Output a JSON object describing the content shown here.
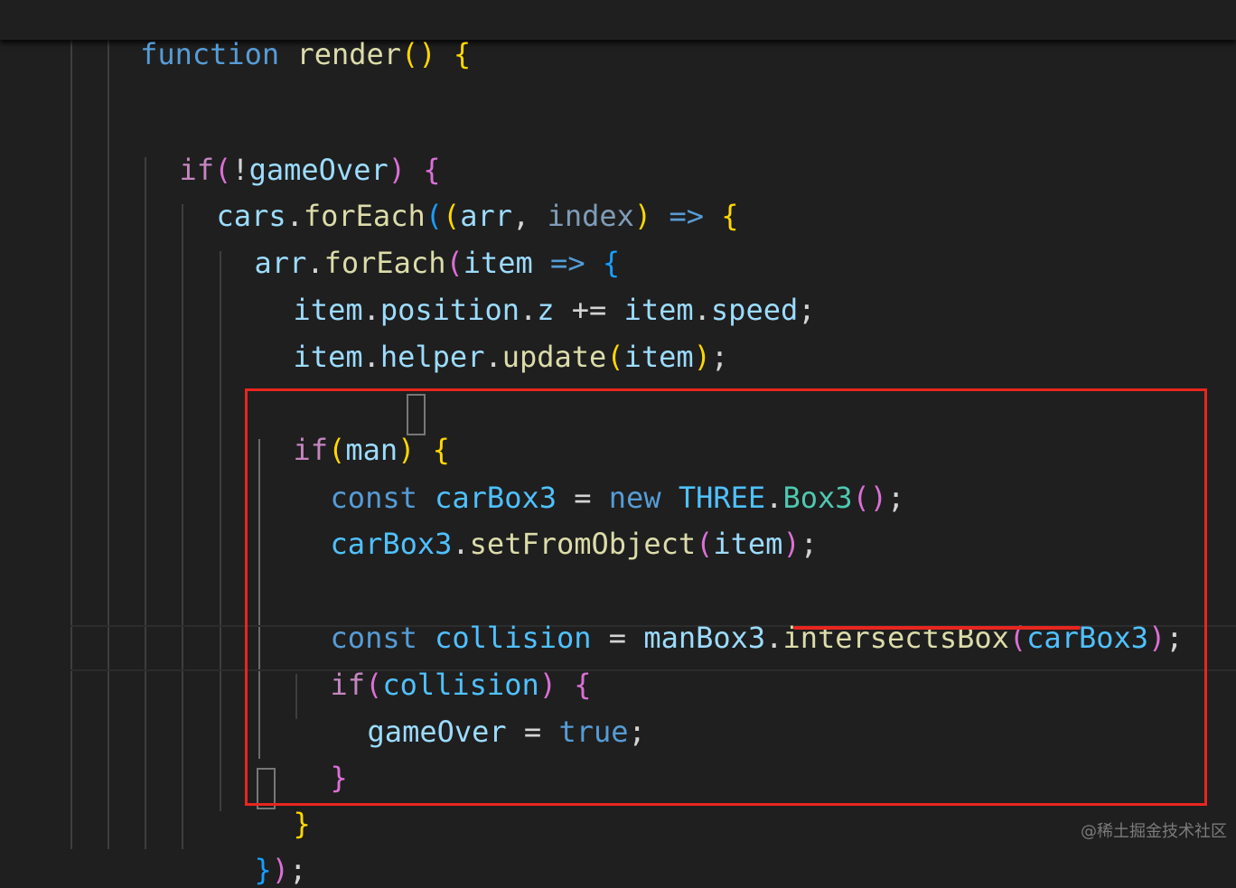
{
  "editor": {
    "sticky_line": {
      "kw": "function",
      "name": "render",
      "parens": "()",
      "brace": "{"
    },
    "partial_brace": "}",
    "line_if_gameover": {
      "kw": "if",
      "open": "(",
      "not": "!",
      "var": "gameOver",
      "close": ")",
      "brace": "{"
    },
    "line_cars_foreach": {
      "obj": "cars",
      "dot": ".",
      "method": "forEach",
      "open": "(",
      "open2": "(",
      "p1": "arr",
      "comma": ",",
      "p2": "index",
      "close2": ")",
      "arrow": "=>",
      "brace": "{"
    },
    "line_arr_foreach": {
      "obj": "arr",
      "dot": ".",
      "method": "forEach",
      "open": "(",
      "param": "item",
      "arrow": "=>",
      "brace": "{"
    },
    "line_position": {
      "obj": "item",
      "dot1": ".",
      "prop1": "position",
      "dot2": ".",
      "prop2": "z",
      "op": "+=",
      "obj2": "item",
      "dot3": ".",
      "prop3": "speed",
      "semi": ";"
    },
    "line_helper": {
      "obj": "item",
      "dot1": ".",
      "prop": "helper",
      "dot2": ".",
      "method": "update",
      "open": "(",
      "arg": "item",
      "close": ")",
      "semi": ";"
    },
    "line_if_man": {
      "kw": "if",
      "open": "(",
      "var": "man",
      "close": ")",
      "brace": "{"
    },
    "line_const_carbox": {
      "kw": "const",
      "name": "carBox3",
      "eq": "=",
      "new": "new",
      "ns": "THREE",
      "dot": ".",
      "cls": "Box3",
      "parens": "()",
      "semi": ";"
    },
    "line_setfrom": {
      "obj": "carBox3",
      "dot": ".",
      "method": "setFromObject",
      "open": "(",
      "arg": "item",
      "close": ")",
      "semi": ";"
    },
    "line_const_collision": {
      "kw": "const",
      "name": "collision",
      "eq": "=",
      "obj": "manBox3",
      "dot": ".",
      "method": "intersectsBox",
      "open": "(",
      "arg": "carBox3",
      "close": ")",
      "semi": ";"
    },
    "line_if_collision": {
      "kw": "if",
      "open": "(",
      "var": "collision",
      "close": ")",
      "brace": "{"
    },
    "line_gameover_true": {
      "var": "gameOver",
      "eq": "=",
      "val": "true",
      "semi": ";"
    },
    "line_close_collision": {
      "brace": "}"
    },
    "line_close_man": {
      "brace": "}"
    },
    "line_close_arr": {
      "brace": "}",
      "paren": ")",
      "semi": ";"
    }
  },
  "watermark": "@稀土掘金技术社区",
  "colors": {
    "background": "#1f1f1f",
    "keyword_blue": "#569cd6",
    "keyword_purple": "#c586c0",
    "function_yellow": "#dcdcaa",
    "variable_lightblue": "#9cdcfe",
    "constant_blue": "#4fc1ff",
    "class_teal": "#4ec9b0",
    "bracket_gold": "#ffd700",
    "bracket_orchid": "#da70d6",
    "bracket_blue": "#179fff",
    "annotation_red": "#e8261f"
  }
}
